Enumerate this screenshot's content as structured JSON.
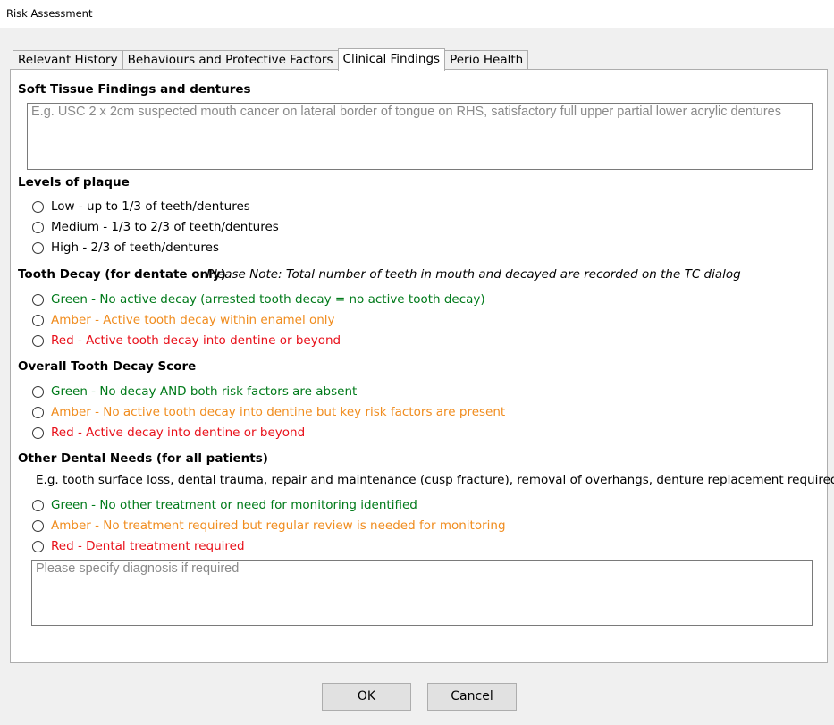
{
  "window": {
    "title": "Risk Assessment"
  },
  "tabs": [
    {
      "label": "Relevant History"
    },
    {
      "label": "Behaviours and Protective Factors"
    },
    {
      "label": "Clinical Findings"
    },
    {
      "label": "Perio Health"
    }
  ],
  "active_tab": "Clinical Findings",
  "soft_tissue": {
    "heading": "Soft Tissue Findings and dentures",
    "placeholder": "E.g. USC 2 x 2cm suspected mouth cancer on lateral border of tongue on RHS, satisfactory full upper partial lower acrylic dentures",
    "value": ""
  },
  "plaque": {
    "heading": "Levels of plaque",
    "options": [
      {
        "label": "Low - up to 1/3 of teeth/dentures"
      },
      {
        "label": "Medium - 1/3 to 2/3 of teeth/dentures"
      },
      {
        "label": "High - 2/3 of teeth/dentures"
      }
    ]
  },
  "tooth_decay": {
    "heading": "Tooth Decay (for dentate only)",
    "note": "Please Note: Total number of teeth in mouth and decayed are recorded on the TC dialog",
    "options": [
      {
        "label": "Green - No active decay (arrested tooth decay = no active tooth decay)",
        "color": "green"
      },
      {
        "label": "Amber - Active tooth decay within enamel only",
        "color": "amber"
      },
      {
        "label": "Red - Active tooth decay into dentine or beyond",
        "color": "red"
      }
    ]
  },
  "overall_decay": {
    "heading": "Overall Tooth Decay Score",
    "options": [
      {
        "label": "Green - No decay AND both risk factors are absent",
        "color": "green"
      },
      {
        "label": "Amber - No active tooth decay into dentine but key risk factors are present",
        "color": "amber"
      },
      {
        "label": "Red - Active decay into dentine or beyond",
        "color": "red"
      }
    ]
  },
  "other_needs": {
    "heading": "Other Dental Needs (for all patients)",
    "example": "E.g. tooth surface loss, dental trauma, repair and maintenance (cusp fracture), removal of overhangs, denture replacement required etc.",
    "options": [
      {
        "label": "Green - No other treatment or need for monitoring identified",
        "color": "green"
      },
      {
        "label": "Amber - No treatment required but regular review is needed for monitoring",
        "color": "amber"
      },
      {
        "label": "Red - Dental treatment required",
        "color": "red"
      }
    ],
    "placeholder": "Please specify diagnosis if required",
    "value": ""
  },
  "buttons": {
    "ok": "OK",
    "cancel": "Cancel"
  },
  "colors": {
    "green": "#007a1a",
    "amber": "#f08c1e",
    "red": "#e8101a"
  }
}
